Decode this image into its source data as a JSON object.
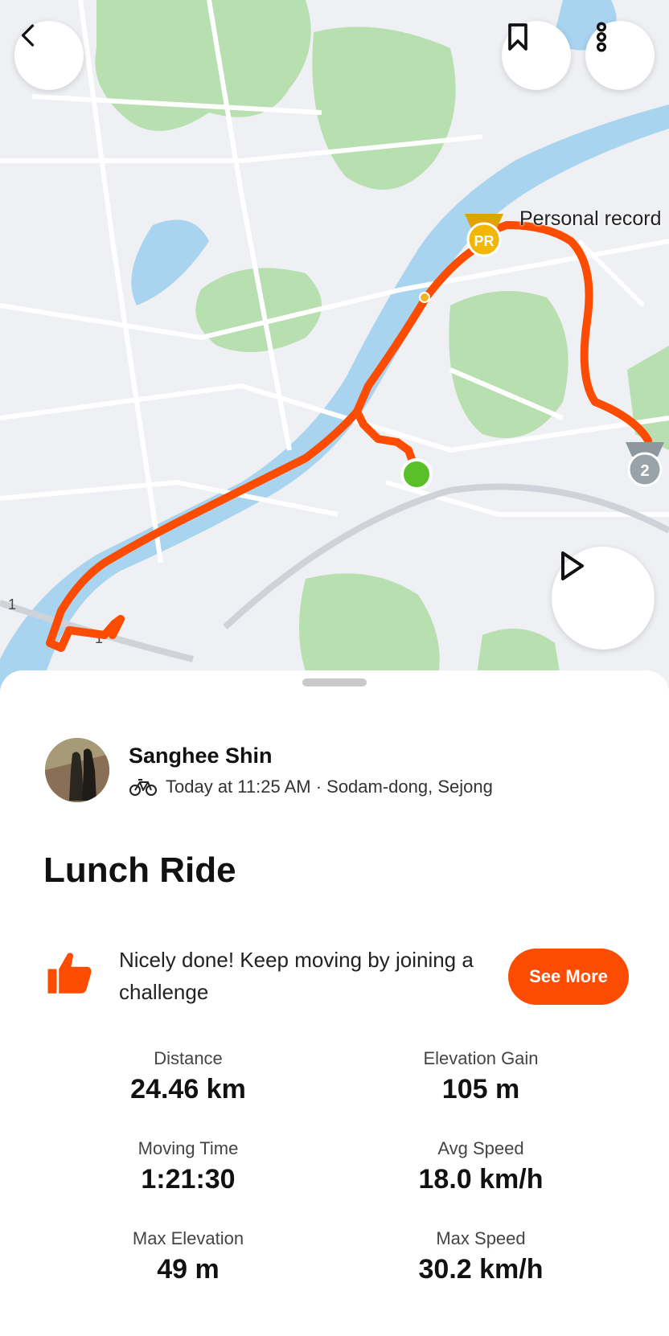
{
  "map": {
    "pr_label": "Personal record",
    "pr_badge": "PR",
    "rank_badge": "2",
    "road_label_1": "1",
    "road_label_2": "1",
    "route_color": "#fc4c02"
  },
  "nav": {
    "back_icon": "chevron-left-icon",
    "bookmark_icon": "bookmark-icon",
    "more_icon": "more-vertical-icon",
    "play_icon": "play-icon"
  },
  "athlete": {
    "name": "Sanghee Shin",
    "activity_icon": "bike-icon",
    "meta": "Today at 11:25 AM · Sodam-dong, Sejong"
  },
  "activity": {
    "title": "Lunch Ride"
  },
  "challenge": {
    "icon": "thumbs-up-icon",
    "text": "Nicely done! Keep moving by joining a challenge",
    "button_label": "See More"
  },
  "stats": [
    {
      "label": "Distance",
      "value": "24.46 km"
    },
    {
      "label": "Elevation Gain",
      "value": "105 m"
    },
    {
      "label": "Moving Time",
      "value": "1:21:30"
    },
    {
      "label": "Avg Speed",
      "value": "18.0 km/h"
    },
    {
      "label": "Max Elevation",
      "value": "49 m"
    },
    {
      "label": "Max Speed",
      "value": "30.2 km/h"
    }
  ],
  "colors": {
    "accent": "#fc4c02",
    "water": "#a8d4f0",
    "park": "#a9d9a0",
    "start_dot": "#5ac02a"
  }
}
